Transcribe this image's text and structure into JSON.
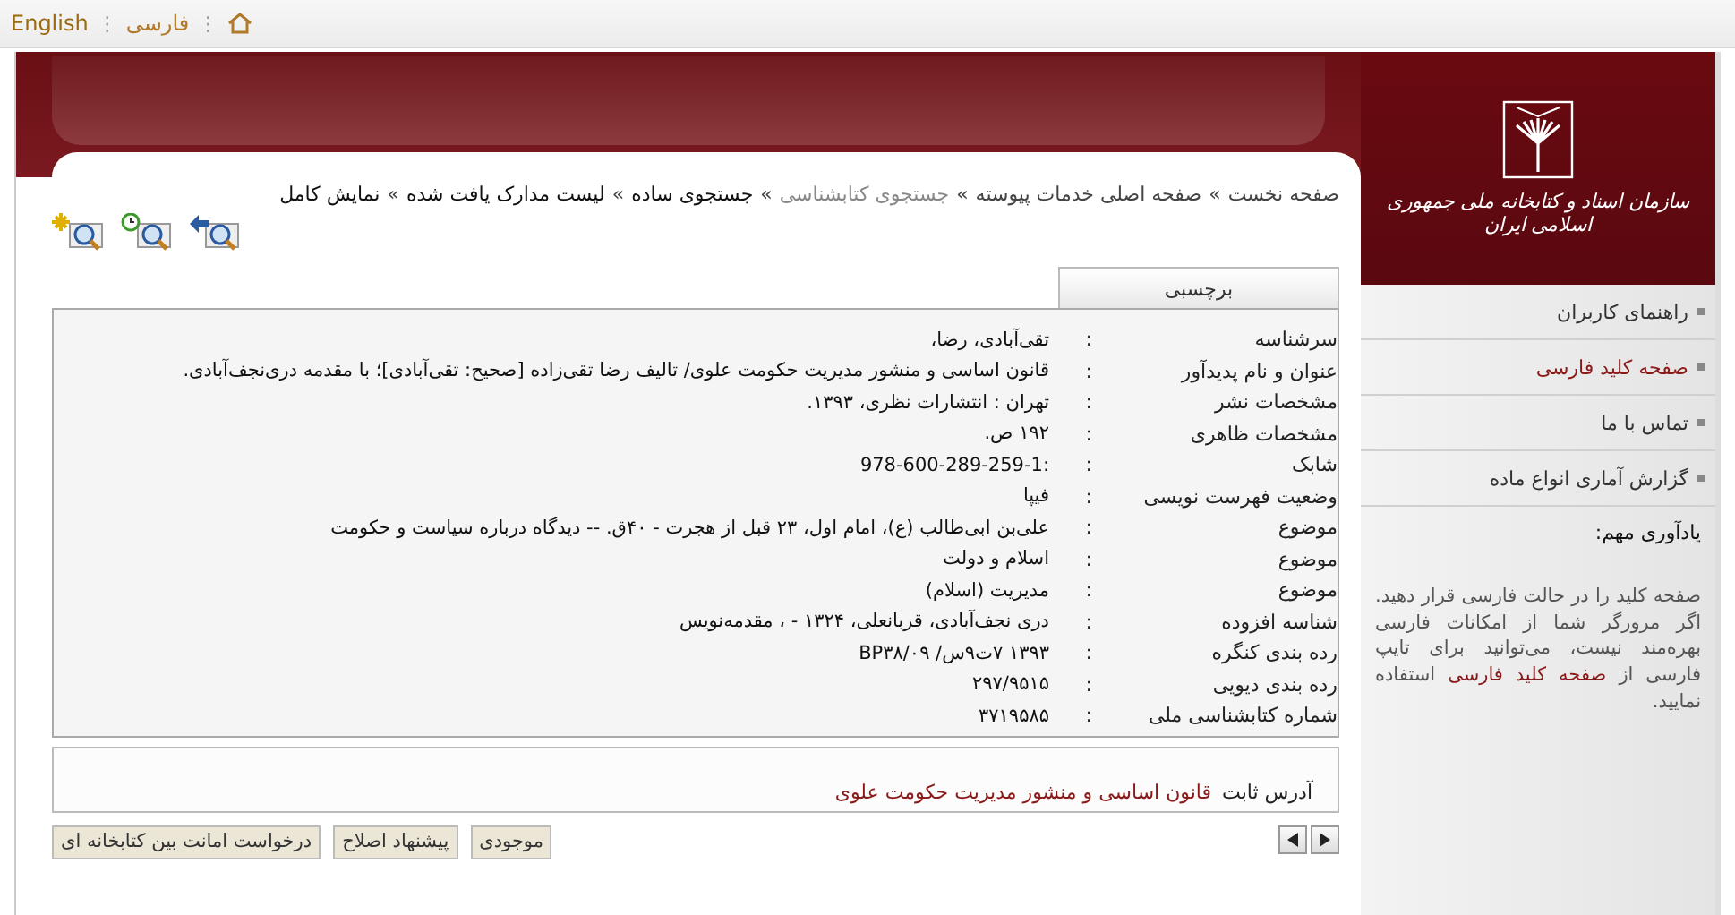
{
  "top_bar": {
    "languages": [
      {
        "label": "فارسی",
        "selected": true
      },
      {
        "label": "English",
        "selected": false
      }
    ],
    "separator": "⋮"
  },
  "logo": {
    "text": "سازمان اسناد و کتابخانه ملی جمهوری اسلامی ایران"
  },
  "breadcrumb": {
    "separator": "»",
    "items": [
      {
        "label": "صفحه نخست",
        "kind": "link"
      },
      {
        "label": "صفحه اصلی خدمات پیوسته",
        "kind": "link"
      },
      {
        "label": "جستجوی کتابشناسی",
        "kind": "muted"
      },
      {
        "label": "جستجوی ساده",
        "kind": "current"
      },
      {
        "label": "لیست مدارک یافت شده",
        "kind": "current"
      },
      {
        "label": "نمایش کامل",
        "kind": "current"
      }
    ]
  },
  "tabs": [
    {
      "label": "برچسبی",
      "selected": true
    }
  ],
  "record": {
    "separator": ":",
    "rows": [
      {
        "label": "سرشناسه",
        "value": "تقی‌آبادی، رضا،"
      },
      {
        "label": "عنوان و نام پدیدآور",
        "value": "قانون اساسی و منشور مدیریت حکومت علوی/ تالیف رضا تقی‌زاده [صحیح: تقی‌آبادی]؛ با مقدمه دری‌نجف‌آبادی."
      },
      {
        "label": "مشخصات نشر",
        "value": "تهران : انتشارات نظری، ۱۳۹۳."
      },
      {
        "label": "مشخصات ظاهری",
        "value": "۱۹۲ ص."
      },
      {
        "label": "شابک",
        "value": ":978-600-289-259-1"
      },
      {
        "label": "وضعیت فهرست نویسی",
        "value": "فیپا"
      },
      {
        "label": "موضوع",
        "value": "علی‌بن ابی‌طالب (ع)، امام اول، ۲۳ قبل از هجرت - ۴۰ق. -- دیدگاه درباره سیاست و حکومت"
      },
      {
        "label": "موضوع",
        "value": "اسلام و دولت"
      },
      {
        "label": "موضوع",
        "value": "مدیریت (اسلام)"
      },
      {
        "label": "شناسه افزوده",
        "value": "دری نجف‌آبادی، قربانعلی، ۱۳۲۴ - ، مقدمه‌نویس"
      },
      {
        "label": "رده بندی کنگره",
        "value": "۱۳۹۳ ۷ت۹س/ BP۳۸/۰۹"
      },
      {
        "label": "رده بندی دیویی",
        "value": "۲۹۷/۹۵۱۵"
      },
      {
        "label": "شماره کتابشناسی ملی",
        "value": "۳۷۱۹۵۸۵"
      }
    ]
  },
  "permalink": {
    "label": "آدرس ثابت",
    "link": "قانون اساسی و منشور مدیریت حکومت علوی"
  },
  "buttons": [
    "موجودی",
    "پیشنهاد اصلاح",
    "درخواست امانت بین کتابخانه ای"
  ],
  "sidebar": {
    "items": [
      {
        "label": "راهنمای کاربران",
        "selected": false
      },
      {
        "label": "صفحه کلید فارسی",
        "selected": true
      },
      {
        "label": "تماس با ما",
        "selected": false
      },
      {
        "label": "گزارش آماری انواع ماده",
        "selected": false
      }
    ],
    "note": {
      "title": "یادآوری مهم:",
      "text_before": "صفحه کلید را در حالت فارسی قرار دهید. اگر مرورگر شما از امکانات فارسی بهره‌مند نیست، می‌توانید برای تایپ فارسی از",
      "link": "صفحه کلید فارسی",
      "text_after": "استفاده نمایید."
    }
  }
}
